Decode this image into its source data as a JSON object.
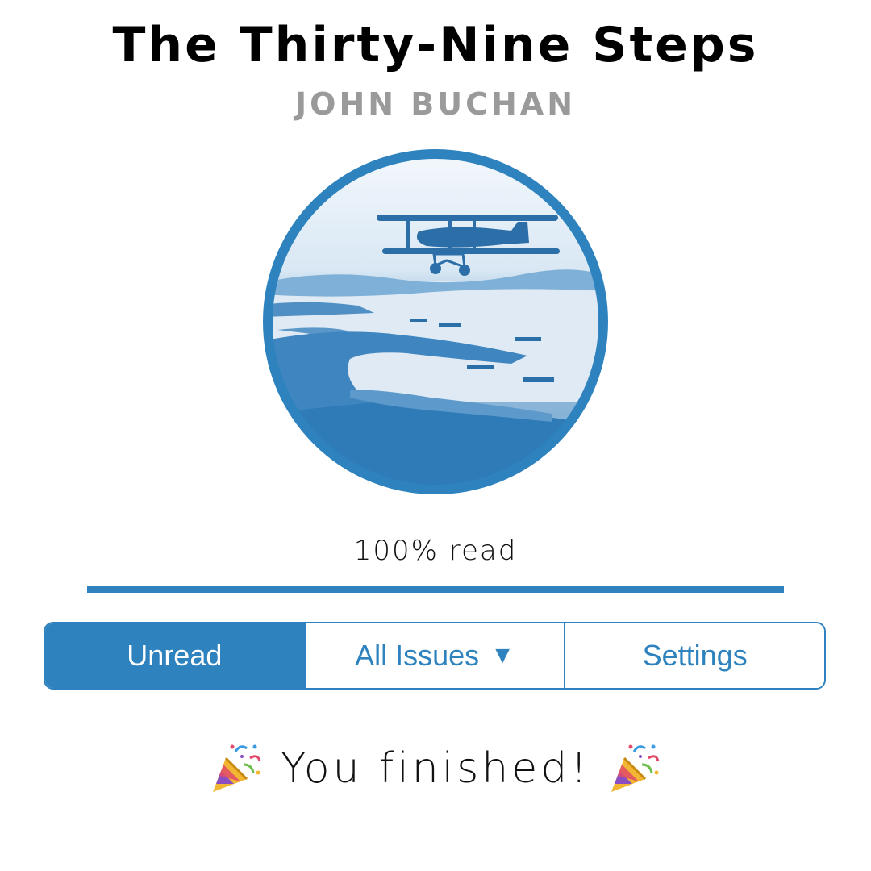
{
  "book": {
    "title": "The Thirty-Nine Steps",
    "author": "JOHN BUCHAN"
  },
  "progress": {
    "label": "100% read",
    "fraction": 1.0
  },
  "tabs": [
    {
      "label": "Unread",
      "active": true
    },
    {
      "label": "All Issues",
      "caret": "▼",
      "active": false
    },
    {
      "label": "Settings",
      "active": false
    }
  ],
  "completion": {
    "message": "You finished!",
    "icon": "party-popper-icon"
  },
  "colors": {
    "accent": "#2e83bf",
    "author": "#9a9a9a",
    "text": "#111111"
  },
  "cover": {
    "icon": "biplane-over-harbor-illustration"
  }
}
